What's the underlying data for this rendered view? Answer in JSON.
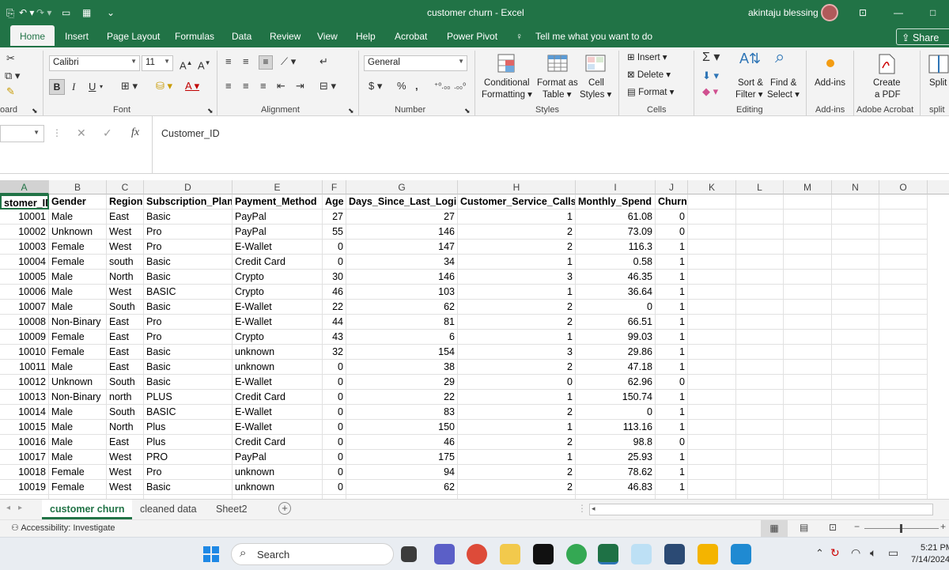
{
  "title_bar": {
    "title": "customer churn  -  Excel",
    "user": "akintaju blessing",
    "minimize": "—",
    "maximize": "□"
  },
  "tabs": [
    "Home",
    "Insert",
    "Page Layout",
    "Formulas",
    "Data",
    "Review",
    "View",
    "Help",
    "Acrobat",
    "Power Pivot"
  ],
  "tell_me": "Tell me what you want to do",
  "share": "Share",
  "ribbon": {
    "font_name": "Calibri",
    "font_size": "11",
    "number_format": "General",
    "groups": {
      "clipboard": "oard",
      "font": "Font",
      "alignment": "Alignment",
      "number": "Number",
      "styles": "Styles",
      "cells": "Cells",
      "editing": "Editing",
      "addins": "Add-ins",
      "acrobat": "Adobe Acrobat",
      "split": "split"
    },
    "styles": {
      "conditional1": "Conditional",
      "conditional2": "Formatting",
      "format_table1": "Format as",
      "format_table2": "Table",
      "cell_styles1": "Cell",
      "cell_styles2": "Styles"
    },
    "cells": {
      "insert": "Insert",
      "delete": "Delete",
      "format": "Format"
    },
    "editing": {
      "sort1": "Sort &",
      "sort2": "Filter",
      "find1": "Find &",
      "find2": "Select"
    },
    "addins": "Add-ins",
    "pdf1": "Create",
    "pdf2": "a PDF",
    "split": "Split"
  },
  "formula_bar": {
    "fx": "fx",
    "value": "Customer_ID"
  },
  "columns": [
    "A",
    "B",
    "C",
    "D",
    "E",
    "F",
    "G",
    "H",
    "I",
    "J",
    "K",
    "L",
    "M",
    "N",
    "O"
  ],
  "headers": [
    "stomer_ID",
    "Gender",
    "Region",
    "Subscription_Plan",
    "Payment_Method",
    "Age",
    "Days_Since_Last_Login",
    "Customer_Service_Calls",
    "Monthly_Spend",
    "Churn"
  ],
  "rows": [
    [
      "10001",
      "Male",
      "East",
      "Basic",
      "PayPal",
      "27",
      "27",
      "1",
      "61.08",
      "0"
    ],
    [
      "10002",
      "Unknown",
      "West",
      "Pro",
      "PayPal",
      "55",
      "146",
      "2",
      "73.09",
      "0"
    ],
    [
      "10003",
      "Female",
      "West",
      "Pro",
      "E-Wallet",
      "0",
      "147",
      "2",
      "116.3",
      "1"
    ],
    [
      "10004",
      "Female",
      "south",
      "Basic",
      "Credit Card",
      "0",
      "34",
      "1",
      "0.58",
      "1"
    ],
    [
      "10005",
      "Male",
      "North",
      "Basic",
      "Crypto",
      "30",
      "146",
      "3",
      "46.35",
      "1"
    ],
    [
      "10006",
      "Male",
      "West",
      "BASIC",
      "Crypto",
      "46",
      "103",
      "1",
      "36.64",
      "1"
    ],
    [
      "10007",
      "Male",
      "South",
      "Basic",
      "E-Wallet",
      "22",
      "62",
      "2",
      "0",
      "1"
    ],
    [
      "10008",
      "Non-Binary",
      "East",
      "Pro",
      "E-Wallet",
      "44",
      "81",
      "2",
      "66.51",
      "1"
    ],
    [
      "10009",
      "Female",
      "East",
      "Pro",
      "Crypto",
      "43",
      "6",
      "1",
      "99.03",
      "1"
    ],
    [
      "10010",
      "Female",
      "East",
      "Basic",
      "unknown",
      "32",
      "154",
      "3",
      "29.86",
      "1"
    ],
    [
      "10011",
      "Male",
      "East",
      "Basic",
      "unknown",
      "0",
      "38",
      "2",
      "47.18",
      "1"
    ],
    [
      "10012",
      "Unknown",
      "South",
      "Basic",
      "E-Wallet",
      "0",
      "29",
      "0",
      "62.96",
      "0"
    ],
    [
      "10013",
      "Non-Binary",
      "north",
      "PLUS",
      "Credit Card",
      "0",
      "22",
      "1",
      "150.74",
      "1"
    ],
    [
      "10014",
      "Male",
      "South",
      "BASIC",
      "E-Wallet",
      "0",
      "83",
      "2",
      "0",
      "1"
    ],
    [
      "10015",
      "Male",
      "North",
      "Plus",
      "E-Wallet",
      "0",
      "150",
      "1",
      "113.16",
      "1"
    ],
    [
      "10016",
      "Male",
      "East",
      "Plus",
      "Credit Card",
      "0",
      "46",
      "2",
      "98.8",
      "0"
    ],
    [
      "10017",
      "Male",
      "West",
      "PRO",
      "PayPal",
      "0",
      "175",
      "1",
      "25.93",
      "1"
    ],
    [
      "10018",
      "Female",
      "West",
      "Pro",
      "unknown",
      "0",
      "94",
      "2",
      "78.62",
      "1"
    ],
    [
      "10019",
      "Female",
      "West",
      "Basic",
      "unknown",
      "0",
      "62",
      "2",
      "46.83",
      "1"
    ]
  ],
  "sheets": [
    "customer churn",
    "cleaned data",
    "Sheet2"
  ],
  "status": {
    "accessibility": "Accessibility: Investigate"
  },
  "taskbar": {
    "search": "Search",
    "time": "5:21 PM",
    "date": "7/14/2024"
  }
}
